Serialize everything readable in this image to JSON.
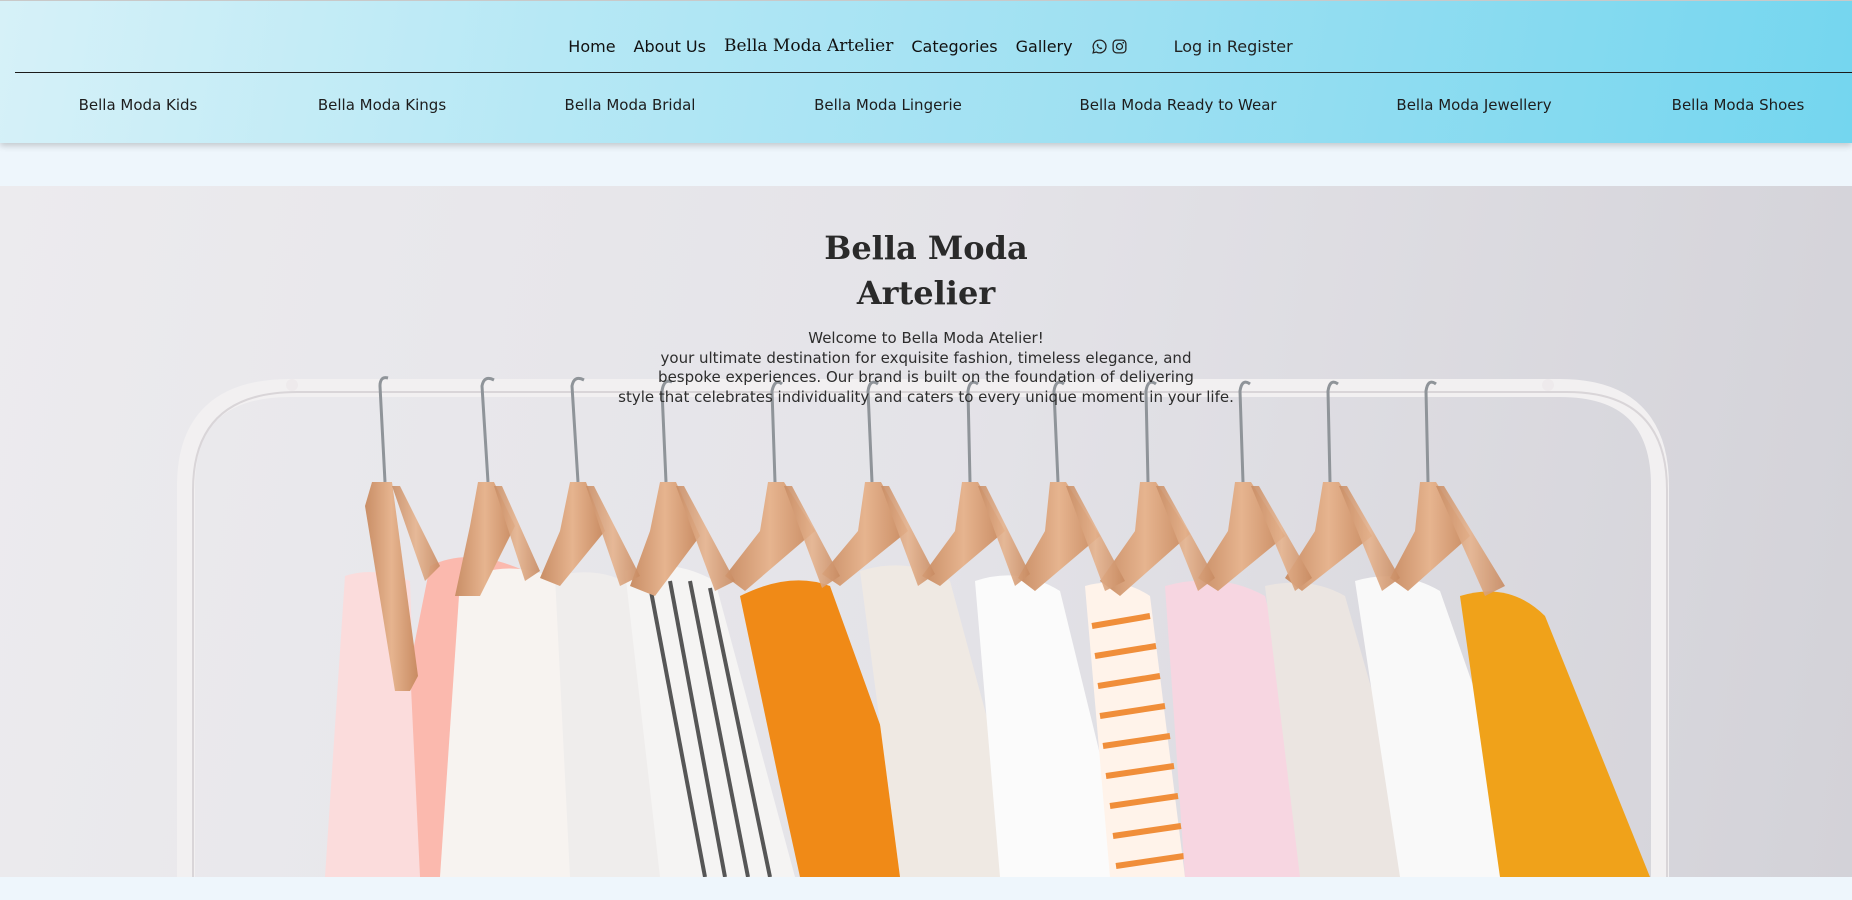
{
  "topnav": {
    "home": "Home",
    "about": "About Us",
    "brand": "Bella Moda Artelier",
    "categories": "Categories",
    "gallery": "Gallery",
    "social_icons": [
      "whatsapp-icon",
      "instagram-icon"
    ],
    "login": "Log in",
    "register": "Register"
  },
  "subnav": {
    "items": [
      "Bella Moda Kids",
      "Bella Moda Kings",
      "Bella Moda Bridal",
      "Bella Moda Lingerie",
      "Bella Moda Ready to Wear",
      "Bella Moda Jewellery",
      "Bella Moda Shoes"
    ]
  },
  "hero": {
    "title_line1": "Bella Moda",
    "title_line2": "Artelier",
    "text_lines": [
      "Welcome to Bella Moda Atelier!",
      "your ultimate destination for exquisite fashion, timeless elegance, and",
      "bespoke experiences. Our brand is built on the foundation of delivering",
      "style that celebrates individuality and caters to every unique moment in your life."
    ]
  },
  "colors": {
    "header_gradient_start": "#d6f1f8",
    "header_gradient_end": "#74d6ef",
    "page_background": "#eef6fc",
    "text": "#222222"
  }
}
